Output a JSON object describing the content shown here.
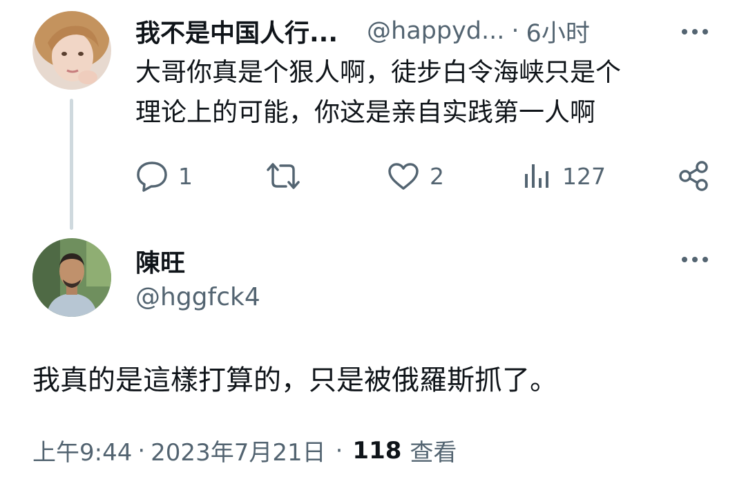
{
  "reply": {
    "display_name": "我不是中国人行...",
    "handle": "@happyd...",
    "separator": "·",
    "time": "6小时",
    "text_line1": "大哥你真是个狠人啊，徒步白令海峡只是个",
    "text_line2": "理论上的可能，你这是亲自实践第一人啊",
    "actions": {
      "reply_count": "1",
      "retweet_count": "",
      "like_count": "2",
      "views_count": "127"
    }
  },
  "main": {
    "display_name": "陳旺",
    "handle": "@hggfck4",
    "text": "我真的是這樣打算的，只是被俄羅斯抓了。",
    "time": "上午9:44",
    "sep1": "·",
    "date": "2023年7月21日",
    "sep2": "·",
    "views_count": "118",
    "views_label": "查看"
  },
  "colors": {
    "text": "#0f1419",
    "muted": "#536471",
    "thread_line": "#cfd9de"
  },
  "icons": [
    "reply-icon",
    "retweet-icon",
    "like-icon",
    "views-icon",
    "share-icon",
    "more-icon"
  ]
}
